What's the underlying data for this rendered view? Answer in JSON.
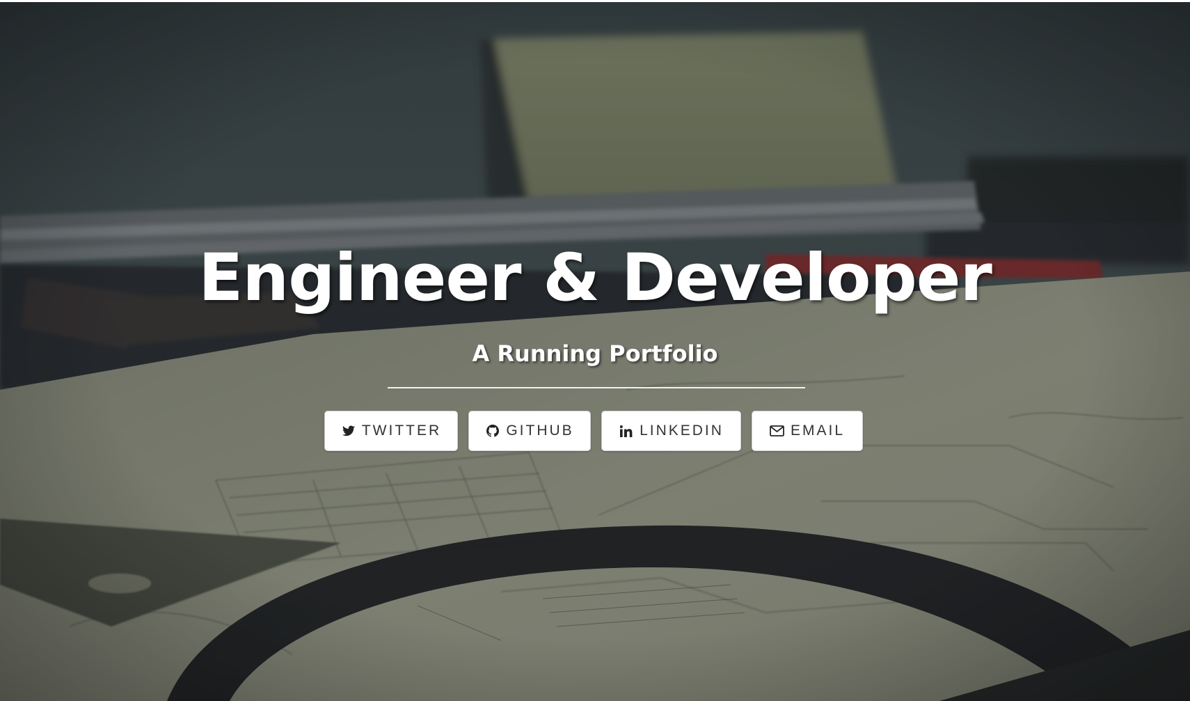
{
  "hero": {
    "title": "Engineer & Developer",
    "subtitle": "A Running Portfolio"
  },
  "social": {
    "buttons": [
      {
        "label": "TWITTER",
        "icon": "twitter-icon"
      },
      {
        "label": "GITHUB",
        "icon": "github-icon"
      },
      {
        "label": "LINKEDIN",
        "icon": "linkedin-icon"
      },
      {
        "label": "EMAIL",
        "icon": "envelope-icon"
      }
    ]
  },
  "colors": {
    "title_text": "#ffffff",
    "button_bg": "#ffffff",
    "button_text": "#333333",
    "background_wall": "#3c4546",
    "background_paper": "#a9ab98"
  }
}
